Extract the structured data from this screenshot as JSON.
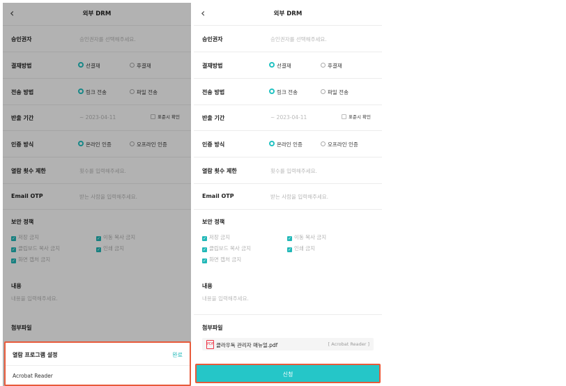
{
  "screens": [
    {
      "id": "left"
    },
    {
      "id": "right"
    }
  ],
  "header": {
    "title": "외부 DRM",
    "back_glyph": "‹"
  },
  "approver": {
    "label": "승인권자",
    "placeholder": "승인권자를 선택해주세요."
  },
  "payment": {
    "label": "결재방법",
    "options": [
      "선결재",
      "후결재"
    ],
    "selected": 0
  },
  "transfer": {
    "label": "전송 방법",
    "options": [
      "링크 전송",
      "파일 전송"
    ],
    "selected": 0
  },
  "export_period": {
    "label": "반출 기간",
    "value": "~ 2023-04-11",
    "standard_check": "표준시 확인"
  },
  "auth": {
    "label": "인증 방식",
    "options": [
      "온라인 인증",
      "오프라인 인증"
    ],
    "selected": 0
  },
  "view_limit": {
    "label": "열람 횟수 제한",
    "placeholder": "횟수를 입력해주세요."
  },
  "email_otp": {
    "label": "Email OTP",
    "placeholder": "받는 사람을 입력해주세요."
  },
  "security": {
    "label": "보안 정책",
    "items": [
      "저장 금지",
      "이동 복사 금지",
      "클립보드 복사 금지",
      "인쇄 금지",
      "화면 캡처 금지"
    ]
  },
  "content": {
    "label": "내용",
    "placeholder": "내용을 입력해주세요."
  },
  "attachment": {
    "label": "첨부파일",
    "file_name": "클라우독 관리자 매뉴얼.pdf",
    "program": "[ Acrobat Reader ]",
    "file_icon": "PDF"
  },
  "sheet": {
    "title": "열람 프로그램 설정",
    "done": "완료",
    "option": "Acrobat Reader"
  },
  "submit_label": "신청",
  "colors": {
    "accent": "#25c6c8",
    "highlight": "#e85a3a"
  }
}
